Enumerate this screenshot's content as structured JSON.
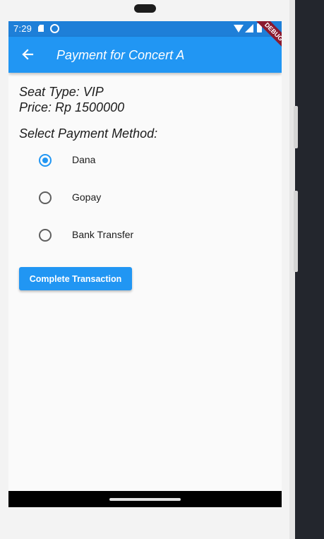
{
  "status_bar": {
    "time": "7:29",
    "icons": [
      "sd-card-icon",
      "settings-gear-icon",
      "wifi-icon",
      "signal-icon",
      "battery-icon"
    ],
    "debug_banner": "DEBUG"
  },
  "app_bar": {
    "back_icon": "arrow-back-icon",
    "title": "Payment for Concert A",
    "color": "#2196f3"
  },
  "details": {
    "seat_type": "Seat Type: VIP",
    "price": "Price: Rp 1500000"
  },
  "payment": {
    "heading": "Select Payment Method:",
    "options": [
      {
        "label": "Dana",
        "selected": true
      },
      {
        "label": "Gopay",
        "selected": false
      },
      {
        "label": "Bank Transfer",
        "selected": false
      }
    ]
  },
  "actions": {
    "complete_label": "Complete Transaction"
  }
}
